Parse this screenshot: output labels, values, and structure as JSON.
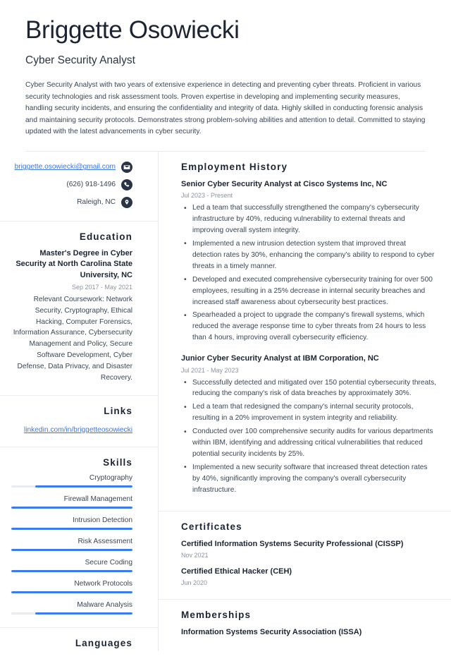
{
  "header": {
    "name": "Briggette Osowiecki",
    "job_title": "Cyber Security Analyst",
    "summary": "Cyber Security Analyst with two years of extensive experience in detecting and preventing cyber threats. Proficient in various security technologies and risk assessment tools. Proven expertise in developing and implementing security measures, handling security incidents, and ensuring the confidentiality and integrity of data. Highly skilled in conducting forensic analysis and maintaining security protocols. Demonstrates strong problem-solving abilities and attention to detail. Committed to staying updated with the latest advancements in cyber security."
  },
  "colors": {
    "text_dark": "#1c2433",
    "text_body": "#3b4554",
    "text_muted": "#8d93a1",
    "link_blue": "#3f74e3",
    "accent_blue": "#3b7bf0",
    "icon_circle": "#2b3444",
    "divider": "#ebedf0",
    "track_gray": "#e9ebee"
  },
  "contact": {
    "email": {
      "value": "briggette.osowiecki@gmail.com",
      "icon": "envelope-icon"
    },
    "phone": {
      "value": "(626) 918-1496",
      "icon": "phone-icon"
    },
    "location": {
      "value": "Raleigh, NC",
      "icon": "map-pin-icon"
    }
  },
  "education": {
    "heading": "Education",
    "entries": [
      {
        "degree": "Master's Degree in Cyber Security at North Carolina State University, NC",
        "date": "Sep 2017 - May 2021",
        "description": "Relevant Coursework: Network Security, Cryptography, Ethical Hacking, Computer Forensics, Information Assurance, Cybersecurity Management and Policy, Secure Software Development, Cyber Defense, Data Privacy, and Disaster Recovery."
      }
    ]
  },
  "links": {
    "heading": "Links",
    "items": [
      {
        "label": "linkedin.com/in/briggetteosowiecki"
      }
    ]
  },
  "skills": {
    "heading": "Skills",
    "items": [
      {
        "label": "Cryptography",
        "level": 80
      },
      {
        "label": "Firewall Management",
        "level": 100
      },
      {
        "label": "Intrusion Detection",
        "level": 100
      },
      {
        "label": "Risk Assessment",
        "level": 100
      },
      {
        "label": "Secure Coding",
        "level": 100
      },
      {
        "label": "Network Protocols",
        "level": 100
      },
      {
        "label": "Malware Analysis",
        "level": 80
      }
    ]
  },
  "languages": {
    "heading": "Languages"
  },
  "employment": {
    "heading": "Employment History",
    "jobs": [
      {
        "role": "Senior Cyber Security Analyst at Cisco Systems Inc, NC",
        "date": "Jul 2023 - Present",
        "bullets": [
          "Led a team that successfully strengthened the company's cybersecurity infrastructure by 40%, reducing vulnerability to external threats and improving overall system integrity.",
          "Implemented a new intrusion detection system that improved threat detection rates by 30%, enhancing the company's ability to respond to cyber threats in a timely manner.",
          "Developed and executed comprehensive cybersecurity training for over 500 employees, resulting in a 25% decrease in internal security breaches and increased staff awareness about cybersecurity best practices.",
          "Spearheaded a project to upgrade the company's firewall systems, which reduced the average response time to cyber threats from 24 hours to less than 4 hours, improving overall cybersecurity efficiency."
        ]
      },
      {
        "role": "Junior Cyber Security Analyst at IBM Corporation, NC",
        "date": "Jul 2021 - May 2023",
        "bullets": [
          "Successfully detected and mitigated over 150 potential cybersecurity threats, reducing the company's risk of data breaches by approximately 30%.",
          "Led a team that redesigned the company's internal security protocols, resulting in a 20% improvement in system integrity and reliability.",
          "Conducted over 100 comprehensive security audits for various departments within IBM, identifying and addressing critical vulnerabilities that reduced potential security incidents by 25%.",
          "Implemented a new security software that increased threat detection rates by 40%, significantly improving the company's overall cybersecurity infrastructure."
        ]
      }
    ]
  },
  "certificates": {
    "heading": "Certificates",
    "items": [
      {
        "name": "Certified Information Systems Security Professional (CISSP)",
        "date": "Nov 2021"
      },
      {
        "name": "Certified Ethical Hacker (CEH)",
        "date": "Jun 2020"
      }
    ]
  },
  "memberships": {
    "heading": "Memberships",
    "items": [
      {
        "name": "Information Systems Security Association (ISSA)"
      }
    ]
  }
}
